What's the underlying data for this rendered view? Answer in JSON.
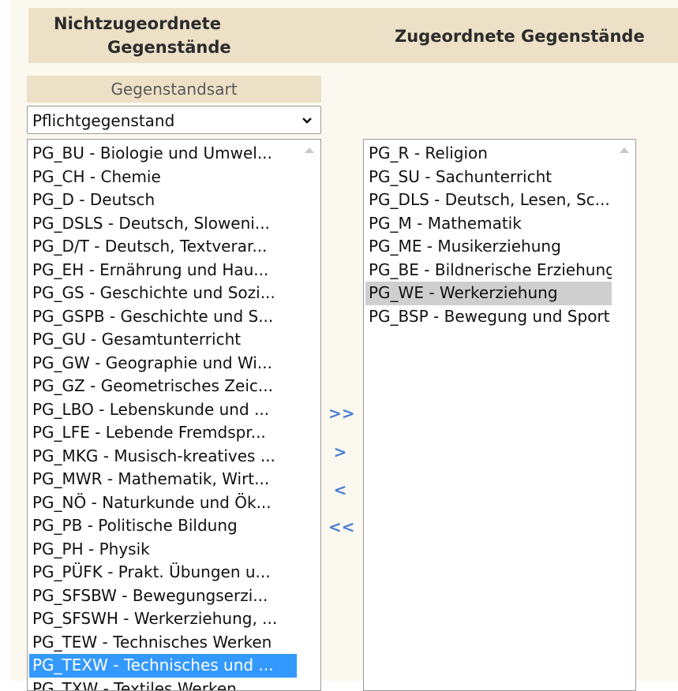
{
  "headers": {
    "left_line1": "Nichtzugeordnete",
    "left_line2": "Gegenstände",
    "right": "Zugeordnete Gegenstände"
  },
  "gegenstandsart": {
    "label": "Gegenstandsart",
    "selected": "Pflichtgegenstand"
  },
  "unassigned": [
    "PG_BU - Biologie und Umwel...",
    "PG_CH - Chemie",
    "PG_D - Deutsch",
    "PG_DSLS - Deutsch, Sloweni...",
    "PG_D/T - Deutsch, Textverar...",
    "PG_EH - Ernährung und Hau...",
    "PG_GS - Geschichte und Sozi...",
    "PG_GSPB - Geschichte und S...",
    "PG_GU - Gesamtunterricht",
    "PG_GW - Geographie und Wi...",
    "PG_GZ - Geometrisches Zeic...",
    "PG_LBO - Lebenskunde und ...",
    "PG_LFE - Lebende Fremdspr...",
    "PG_MKG - Musisch-kreatives ...",
    "PG_MWR - Mathematik, Wirt...",
    "PG_NÖ - Naturkunde und Ök...",
    "PG_PB - Politische Bildung",
    "PG_PH - Physik",
    "PG_PÜFK - Prakt. Übungen u...",
    "PG_SFSBW - Bewegungserzi...",
    "PG_SFSWH - Werkerziehung, ...",
    "PG_TEW - Technisches Werken",
    "PG_TEXW - Technisches und ...",
    "PG_TXW - Textiles Werken"
  ],
  "assigned": [
    "PG_R - Religion",
    "PG_SU - Sachunterricht",
    "PG_DLS - Deutsch, Lesen, Sc...",
    "PG_M - Mathematik",
    "PG_ME - Musikerziehung",
    "PG_BE - Bildnerische Erziehung",
    "PG_WE - Werkerziehung",
    "PG_BSP - Bewegung und Sport"
  ],
  "selected_unassigned_index": 22,
  "selected_assigned_index": 6,
  "move_buttons": {
    "all_right": ">>",
    "right": ">",
    "left": "<",
    "all_left": "<<"
  },
  "colors": {
    "header_bg": "#ece0c6",
    "panel_bg": "#fbf9ef",
    "selection_blue": "#3399ff",
    "selection_grey": "#cfcfcf",
    "arrow_blue": "#4a7fd4"
  }
}
